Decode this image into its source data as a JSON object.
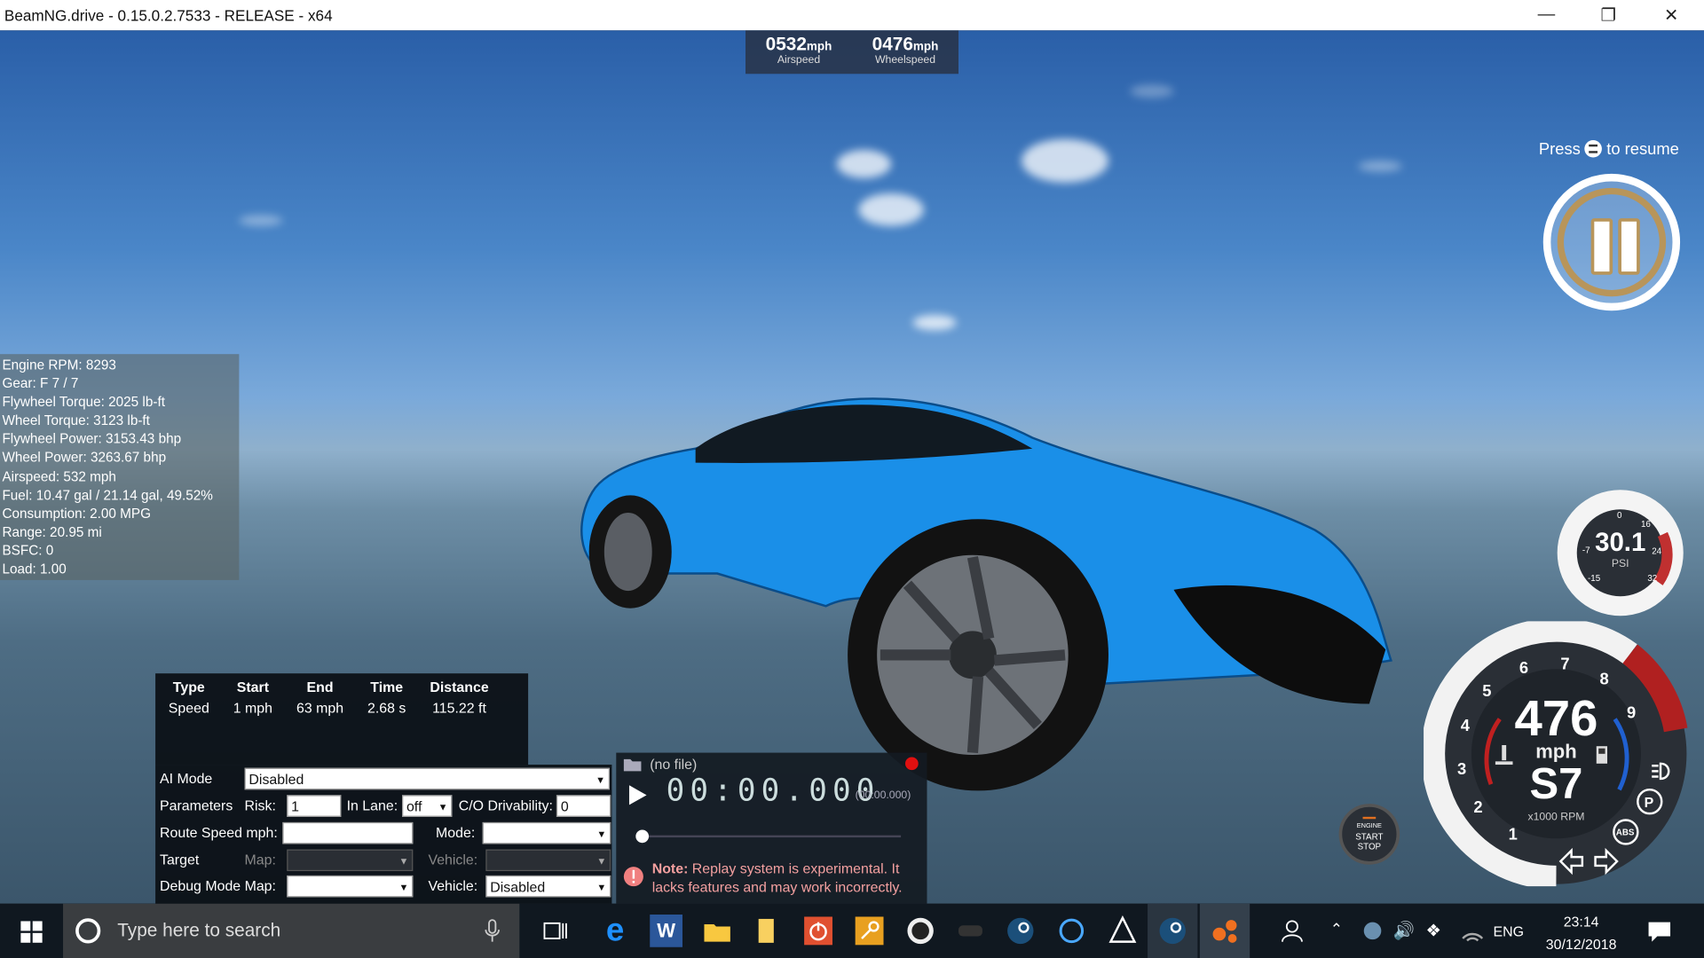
{
  "window": {
    "title": "BeamNG.drive - 0.15.0.2.7533 - RELEASE - x64",
    "minimize": "—",
    "restore": "❐",
    "close": "✕"
  },
  "hud": {
    "airspeed": {
      "value": "0532",
      "unit": "mph",
      "label": "Airspeed"
    },
    "wheelspeed": {
      "value": "0476",
      "unit": "mph",
      "label": "Wheelspeed"
    },
    "resume_prefix": "Press",
    "resume_suffix": "to resume"
  },
  "stats": [
    "Engine RPM: 8293",
    "Gear: F 7 / 7",
    "Flywheel Torque: 2025 lb-ft",
    "Wheel Torque: 3123 lb-ft",
    "Flywheel Power: 3153.43 bhp",
    "Wheel Power: 3263.67 bhp",
    "Airspeed: 532 mph",
    "Fuel: 10.47 gal / 21.14 gal, 49.52%",
    "Consumption: 2.00 MPG",
    "Range: 20.95 mi",
    "BSFC: 0",
    "Load: 1.00"
  ],
  "timing": {
    "headers": [
      "Type",
      "Start",
      "End",
      "Time",
      "Distance"
    ],
    "row": [
      "Speed",
      "1 mph",
      "63 mph",
      "2.68 s",
      "115.22 ft"
    ]
  },
  "ai": {
    "mode_label": "AI Mode",
    "mode_value": "Disabled",
    "params_label": "Parameters",
    "risk_label": "Risk:",
    "risk_value": "1",
    "inlane_label": "In Lane:",
    "inlane_value": "off",
    "co_label": "C/O Drivability:",
    "co_value": "0",
    "route_label": "Route Speed mph:",
    "route_value": "",
    "routemode_label": "Mode:",
    "routemode_value": "",
    "target_label": "Target",
    "map_label": "Map:",
    "vehicle_label": "Vehicle:",
    "debug_label": "Debug Mode Map:",
    "debug_map_value": "",
    "debug_vehicle_label": "Vehicle:",
    "debug_vehicle_value": "Disabled"
  },
  "replay": {
    "file": "(no file)",
    "time": "00:00.000",
    "total": "(00:00.000)",
    "note_label": "Note:",
    "note_text": "Replay system is experimental. It lacks features and may work incorrectly.",
    "record_color": "#e01010",
    "progress": 0
  },
  "boost_gauge": {
    "value": "30.1",
    "unit": "PSI",
    "ticks": [
      "-7",
      "0",
      "16",
      "24",
      "32",
      "-15"
    ]
  },
  "tacho": {
    "speed": "476",
    "speed_unit": "mph",
    "gear": "S7",
    "rpm_label": "x1000 RPM",
    "rpm_ticks": [
      "1",
      "2",
      "3",
      "4",
      "5",
      "6",
      "7",
      "8",
      "9"
    ],
    "redline_color": "#c02020"
  },
  "engine_button": {
    "line1": "ENGINE",
    "line2": "START",
    "line3": "STOP"
  },
  "taskbar": {
    "search_placeholder": "Type here to search",
    "lang": "ENG",
    "time": "23:14",
    "date": "30/12/2018"
  }
}
